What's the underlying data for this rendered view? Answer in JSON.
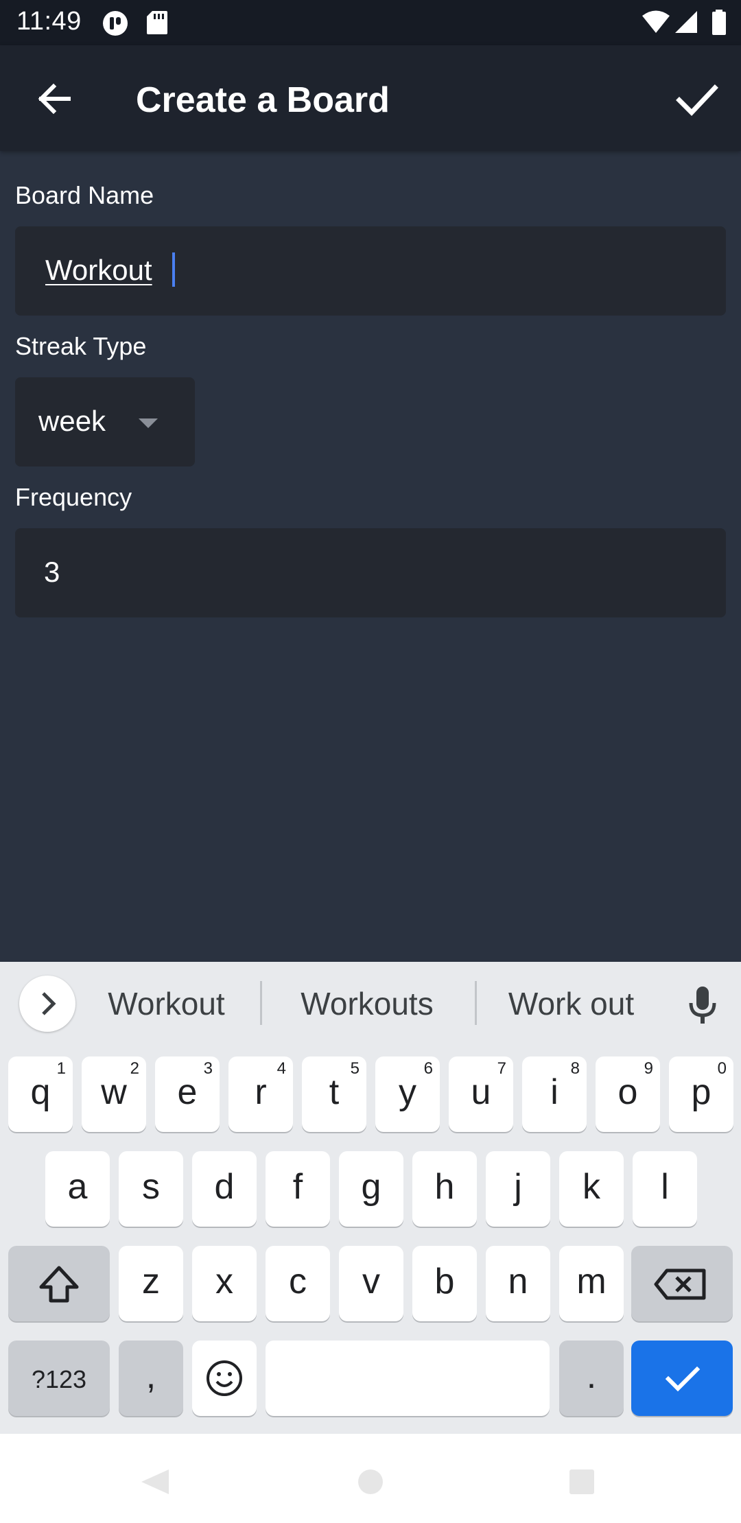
{
  "status_bar": {
    "time": "11:49",
    "icons": [
      "app-icon",
      "sd-card-icon",
      "wifi-icon",
      "signal-icon",
      "battery-icon"
    ]
  },
  "app_bar": {
    "title": "Create a Board",
    "back_icon": "back-arrow-icon",
    "confirm_icon": "check-icon"
  },
  "form": {
    "board_name": {
      "label": "Board Name",
      "value": "Workout"
    },
    "streak_type": {
      "label": "Streak Type",
      "selected": "week"
    },
    "frequency": {
      "label": "Frequency",
      "value": "3"
    }
  },
  "keyboard": {
    "suggestions": [
      "Workout",
      "Workouts",
      "Work out"
    ],
    "row1": [
      {
        "key": "q",
        "hint": "1"
      },
      {
        "key": "w",
        "hint": "2"
      },
      {
        "key": "e",
        "hint": "3"
      },
      {
        "key": "r",
        "hint": "4"
      },
      {
        "key": "t",
        "hint": "5"
      },
      {
        "key": "y",
        "hint": "6"
      },
      {
        "key": "u",
        "hint": "7"
      },
      {
        "key": "i",
        "hint": "8"
      },
      {
        "key": "o",
        "hint": "9"
      },
      {
        "key": "p",
        "hint": "0"
      }
    ],
    "row2": [
      "a",
      "s",
      "d",
      "f",
      "g",
      "h",
      "j",
      "k",
      "l"
    ],
    "row3": [
      "z",
      "x",
      "c",
      "v",
      "b",
      "n",
      "m"
    ],
    "symbols_label": "?123",
    "comma": ",",
    "period": "."
  },
  "colors": {
    "background": "#2a3240",
    "app_bar": "#1e232d",
    "field": "#242830",
    "cursor": "#4a7ff0",
    "keyboard_bg": "#e8eaed",
    "action_key": "#1a73e8"
  }
}
